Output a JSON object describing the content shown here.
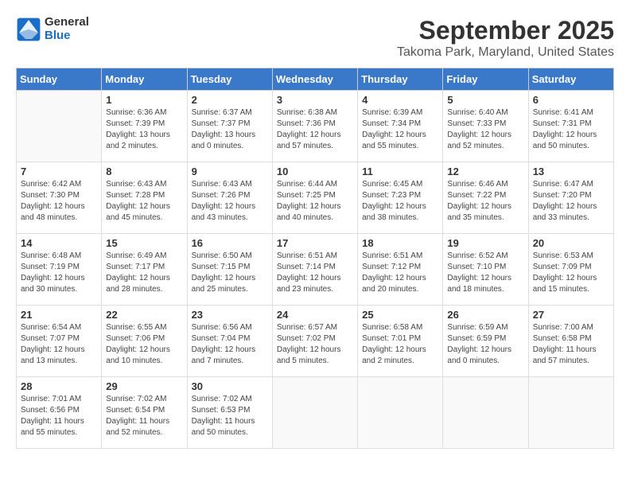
{
  "header": {
    "logo_general": "General",
    "logo_blue": "Blue",
    "month": "September 2025",
    "location": "Takoma Park, Maryland, United States"
  },
  "days_of_week": [
    "Sunday",
    "Monday",
    "Tuesday",
    "Wednesday",
    "Thursday",
    "Friday",
    "Saturday"
  ],
  "weeks": [
    [
      {
        "day": "",
        "info": ""
      },
      {
        "day": "1",
        "info": "Sunrise: 6:36 AM\nSunset: 7:39 PM\nDaylight: 13 hours\nand 2 minutes."
      },
      {
        "day": "2",
        "info": "Sunrise: 6:37 AM\nSunset: 7:37 PM\nDaylight: 13 hours\nand 0 minutes."
      },
      {
        "day": "3",
        "info": "Sunrise: 6:38 AM\nSunset: 7:36 PM\nDaylight: 12 hours\nand 57 minutes."
      },
      {
        "day": "4",
        "info": "Sunrise: 6:39 AM\nSunset: 7:34 PM\nDaylight: 12 hours\nand 55 minutes."
      },
      {
        "day": "5",
        "info": "Sunrise: 6:40 AM\nSunset: 7:33 PM\nDaylight: 12 hours\nand 52 minutes."
      },
      {
        "day": "6",
        "info": "Sunrise: 6:41 AM\nSunset: 7:31 PM\nDaylight: 12 hours\nand 50 minutes."
      }
    ],
    [
      {
        "day": "7",
        "info": "Sunrise: 6:42 AM\nSunset: 7:30 PM\nDaylight: 12 hours\nand 48 minutes."
      },
      {
        "day": "8",
        "info": "Sunrise: 6:43 AM\nSunset: 7:28 PM\nDaylight: 12 hours\nand 45 minutes."
      },
      {
        "day": "9",
        "info": "Sunrise: 6:43 AM\nSunset: 7:26 PM\nDaylight: 12 hours\nand 43 minutes."
      },
      {
        "day": "10",
        "info": "Sunrise: 6:44 AM\nSunset: 7:25 PM\nDaylight: 12 hours\nand 40 minutes."
      },
      {
        "day": "11",
        "info": "Sunrise: 6:45 AM\nSunset: 7:23 PM\nDaylight: 12 hours\nand 38 minutes."
      },
      {
        "day": "12",
        "info": "Sunrise: 6:46 AM\nSunset: 7:22 PM\nDaylight: 12 hours\nand 35 minutes."
      },
      {
        "day": "13",
        "info": "Sunrise: 6:47 AM\nSunset: 7:20 PM\nDaylight: 12 hours\nand 33 minutes."
      }
    ],
    [
      {
        "day": "14",
        "info": "Sunrise: 6:48 AM\nSunset: 7:19 PM\nDaylight: 12 hours\nand 30 minutes."
      },
      {
        "day": "15",
        "info": "Sunrise: 6:49 AM\nSunset: 7:17 PM\nDaylight: 12 hours\nand 28 minutes."
      },
      {
        "day": "16",
        "info": "Sunrise: 6:50 AM\nSunset: 7:15 PM\nDaylight: 12 hours\nand 25 minutes."
      },
      {
        "day": "17",
        "info": "Sunrise: 6:51 AM\nSunset: 7:14 PM\nDaylight: 12 hours\nand 23 minutes."
      },
      {
        "day": "18",
        "info": "Sunrise: 6:51 AM\nSunset: 7:12 PM\nDaylight: 12 hours\nand 20 minutes."
      },
      {
        "day": "19",
        "info": "Sunrise: 6:52 AM\nSunset: 7:10 PM\nDaylight: 12 hours\nand 18 minutes."
      },
      {
        "day": "20",
        "info": "Sunrise: 6:53 AM\nSunset: 7:09 PM\nDaylight: 12 hours\nand 15 minutes."
      }
    ],
    [
      {
        "day": "21",
        "info": "Sunrise: 6:54 AM\nSunset: 7:07 PM\nDaylight: 12 hours\nand 13 minutes."
      },
      {
        "day": "22",
        "info": "Sunrise: 6:55 AM\nSunset: 7:06 PM\nDaylight: 12 hours\nand 10 minutes."
      },
      {
        "day": "23",
        "info": "Sunrise: 6:56 AM\nSunset: 7:04 PM\nDaylight: 12 hours\nand 7 minutes."
      },
      {
        "day": "24",
        "info": "Sunrise: 6:57 AM\nSunset: 7:02 PM\nDaylight: 12 hours\nand 5 minutes."
      },
      {
        "day": "25",
        "info": "Sunrise: 6:58 AM\nSunset: 7:01 PM\nDaylight: 12 hours\nand 2 minutes."
      },
      {
        "day": "26",
        "info": "Sunrise: 6:59 AM\nSunset: 6:59 PM\nDaylight: 12 hours\nand 0 minutes."
      },
      {
        "day": "27",
        "info": "Sunrise: 7:00 AM\nSunset: 6:58 PM\nDaylight: 11 hours\nand 57 minutes."
      }
    ],
    [
      {
        "day": "28",
        "info": "Sunrise: 7:01 AM\nSunset: 6:56 PM\nDaylight: 11 hours\nand 55 minutes."
      },
      {
        "day": "29",
        "info": "Sunrise: 7:02 AM\nSunset: 6:54 PM\nDaylight: 11 hours\nand 52 minutes."
      },
      {
        "day": "30",
        "info": "Sunrise: 7:02 AM\nSunset: 6:53 PM\nDaylight: 11 hours\nand 50 minutes."
      },
      {
        "day": "",
        "info": ""
      },
      {
        "day": "",
        "info": ""
      },
      {
        "day": "",
        "info": ""
      },
      {
        "day": "",
        "info": ""
      }
    ]
  ]
}
